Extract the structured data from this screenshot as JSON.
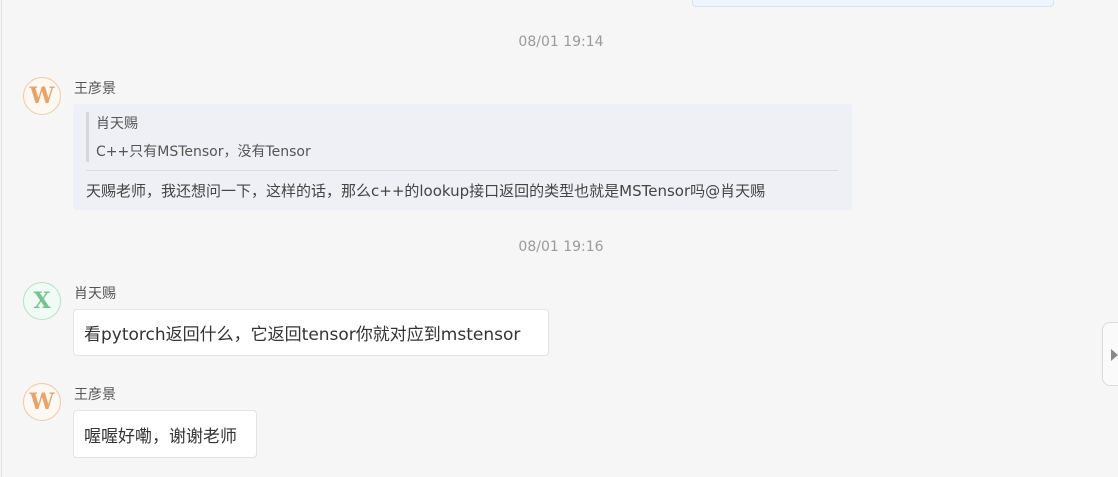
{
  "messages": {
    "ts1": "08/01 19:14",
    "ts2": "08/01 19:16",
    "m1": {
      "avatar": "W",
      "sender": "王彦景",
      "quote_author": "肖天赐",
      "quote_text": "C++只有MSTensor，没有Tensor",
      "text": "天赐老师，我还想问一下，这样的话，那么c++的lookup接口返回的类型也就是MSTensor吗@肖天赐"
    },
    "m2": {
      "avatar": "X",
      "sender": "肖天赐",
      "text": "看pytorch返回什么，它返回tensor你就对应到mstensor"
    },
    "m3": {
      "avatar": "W",
      "sender": "王彦景",
      "text": "喔喔好嘞，谢谢老师"
    }
  },
  "colors": {
    "background": "#f6f6f6",
    "bubble": "#ffffff",
    "quote_bg": "#eef0f5",
    "avatar_w": "#e6a46b",
    "avatar_x": "#77c393",
    "timestamp": "#9a9a9a"
  },
  "icons": {
    "side_toggle": "triangle-right-icon"
  }
}
